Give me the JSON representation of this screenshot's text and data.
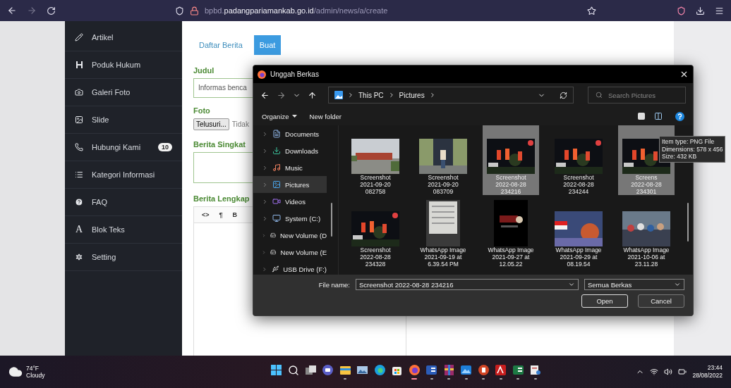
{
  "browser": {
    "forward_disabled": true,
    "url": {
      "prefix": "bpbd.",
      "domain": "padangpariamankab.go.id",
      "path": "/admin/news/a/create"
    }
  },
  "sidebar": {
    "items": [
      {
        "label": "Artikel",
        "kind": "icon"
      },
      {
        "label": "Poduk Hukum",
        "kind": "icon"
      },
      {
        "label": "Galeri Foto",
        "kind": "icon"
      },
      {
        "label": "Slide",
        "kind": "icon"
      },
      {
        "label": "Hubungi Kami",
        "kind": "icon",
        "badge": "10"
      },
      {
        "label": "Kategori Informasi",
        "kind": "icon"
      },
      {
        "label": "FAQ",
        "kind": "icon"
      },
      {
        "label": "Blok Teks",
        "kind": "glyph",
        "glyph": "A"
      },
      {
        "label": "Setting",
        "kind": "icon"
      }
    ]
  },
  "tabs": [
    {
      "label": "Daftar Berita",
      "selected": false
    },
    {
      "label": "Buat",
      "selected": true
    }
  ],
  "form": {
    "title_label": "Judul",
    "title_value": "Informas benca",
    "photo_label": "Foto",
    "browse_button": "Telusuri...",
    "file_status": "Tidak",
    "summary_label": "Berita Singkat",
    "content_label": "Berita Lengkap",
    "editor_tools": [
      "<>",
      "¶",
      "B"
    ]
  },
  "dialog": {
    "title": "Unggah Berkas",
    "forward_disabled": true,
    "breadcrumb": [
      "This PC",
      "Pictures"
    ],
    "search_placeholder": "Search Pictures",
    "organize": "Organize",
    "new_folder": "New folder",
    "nav": [
      {
        "label": "Documents",
        "selected": false
      },
      {
        "label": "Downloads",
        "selected": false
      },
      {
        "label": "Music",
        "selected": false
      },
      {
        "label": "Pictures",
        "selected": true
      },
      {
        "label": "Videos",
        "selected": false
      },
      {
        "label": "System (C:)",
        "selected": false
      },
      {
        "label": "New Volume (D",
        "selected": false
      },
      {
        "label": "New Volume (E",
        "selected": false
      },
      {
        "label": "USB Drive (F:)",
        "selected": false
      }
    ],
    "files": [
      {
        "lines": [
          "Screenshot",
          "2021-09-20",
          "082758"
        ],
        "selected": false,
        "kind": "picture"
      },
      {
        "lines": [
          "Screenshot",
          "2021-09-20",
          "083709"
        ],
        "selected": false,
        "kind": "picture"
      },
      {
        "lines": [
          "Screenshot",
          "2022-08-28",
          "234216"
        ],
        "selected": true,
        "kind": "picture"
      },
      {
        "lines": [
          "Screenshot",
          "2022-08-28",
          "234244"
        ],
        "selected": false,
        "kind": "picture"
      },
      {
        "lines": [
          "Screens",
          "2022-08-28",
          "234301"
        ],
        "selected": true,
        "kind": "picture"
      },
      {
        "lines": [
          "Screenshot",
          "2022-08-28",
          "234328"
        ],
        "selected": false,
        "kind": "picture"
      },
      {
        "lines": [
          "WhatsApp Image",
          "2021-09-19 at",
          "6.39.54 PM"
        ],
        "selected": false,
        "kind": "picture"
      },
      {
        "lines": [
          "WhatsApp Image",
          "2021-09-27 at",
          "12.05.22"
        ],
        "selected": false,
        "kind": "picture"
      },
      {
        "lines": [
          "WhatsApp Image",
          "2021-09-29 at",
          "08.19.54"
        ],
        "selected": false,
        "kind": "picture"
      },
      {
        "lines": [
          "WhatsApp Image",
          "2021-10-06 at",
          "23.11.28"
        ],
        "selected": false,
        "kind": "picture"
      }
    ],
    "tooltip": [
      "Item type: PNG File",
      "Dimensions: 578 x 456",
      "Size: 432 KB"
    ],
    "file_name_label": "File name:",
    "file_name": "Screenshot 2022-08-28 234216",
    "file_type": "Semua Berkas",
    "open": "Open",
    "cancel": "Cancel"
  },
  "taskbar": {
    "temperature": "74°F",
    "weather": "Cloudy",
    "time": "23:44",
    "date": "28/08/2022",
    "apps": [
      {
        "kind": "start",
        "running": false
      },
      {
        "kind": "search",
        "running": false
      },
      {
        "kind": "taskview",
        "running": false
      },
      {
        "kind": "chat",
        "running": false
      },
      {
        "kind": "folder",
        "running": true
      },
      {
        "kind": "photos",
        "running": false
      },
      {
        "kind": "edge",
        "running": false
      },
      {
        "kind": "store",
        "running": false
      },
      {
        "kind": "firefox",
        "running": true
      },
      {
        "kind": "word",
        "running": true
      },
      {
        "kind": "archive",
        "running": true
      },
      {
        "kind": "gallery",
        "running": true
      },
      {
        "kind": "slides",
        "running": true
      },
      {
        "kind": "pdf",
        "running": true
      },
      {
        "kind": "sheet",
        "running": true
      },
      {
        "kind": "tool",
        "running": true
      }
    ]
  }
}
